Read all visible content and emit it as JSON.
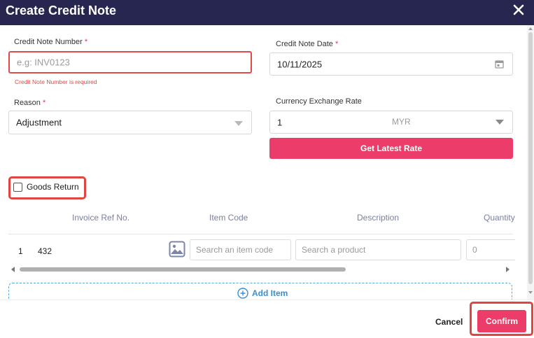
{
  "dialog": {
    "title": "Create Credit Note",
    "close_icon": "close-icon"
  },
  "form": {
    "credit_note_number": {
      "label": "Credit Note Number",
      "required_mark": "*",
      "value": "",
      "placeholder": "e.g: INV0123",
      "error": "Credit Note Number is required"
    },
    "credit_note_date": {
      "label": "Credit Note Date",
      "required_mark": "*",
      "value": "10/11/2025",
      "icon": "calendar-icon"
    },
    "reason": {
      "label": "Reason",
      "required_mark": "*",
      "value": "Adjustment"
    },
    "currency_exchange_rate": {
      "label": "Currency Exchange Rate",
      "value": "1",
      "currency": "MYR"
    },
    "get_latest_rate_label": "Get Latest Rate",
    "goods_return": {
      "label": "Goods Return",
      "checked": false
    }
  },
  "table": {
    "headers": [
      "Invoice Ref No.",
      "Item Code",
      "Description",
      "Quantity"
    ],
    "rows": [
      {
        "index": "1",
        "invoice_ref": "432",
        "item_code_placeholder": "Search an item code",
        "description_placeholder": "Search a product",
        "quantity": "0"
      }
    ]
  },
  "add_item_label": "Add Item",
  "footer": {
    "cancel_label": "Cancel",
    "confirm_label": "Confirm"
  },
  "colors": {
    "header_bg": "#262650",
    "accent": "#ec3c6a",
    "error": "#e04a4a",
    "highlight": "#e0463f",
    "link_blue": "#3a8fd0"
  }
}
